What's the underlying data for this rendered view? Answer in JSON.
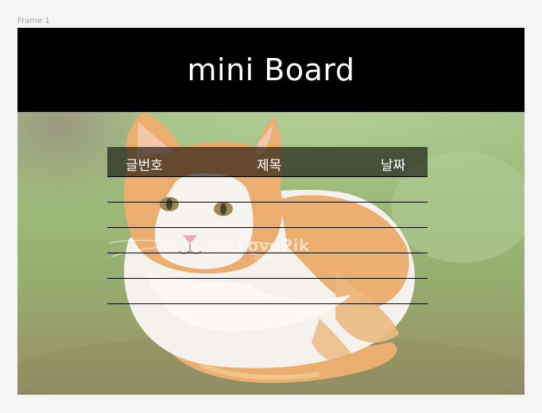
{
  "frame": {
    "label": "Frame 1"
  },
  "header": {
    "title": "mini Board"
  },
  "background_image": {
    "watermark": "LovePik",
    "watermark_sub": "lovepik.com"
  },
  "board": {
    "columns": {
      "number": "글번호",
      "title": "제목",
      "date": "날짜"
    },
    "rows": [
      {
        "number": "",
        "title": "",
        "date": ""
      },
      {
        "number": "",
        "title": "",
        "date": ""
      },
      {
        "number": "",
        "title": "",
        "date": ""
      },
      {
        "number": "",
        "title": "",
        "date": ""
      },
      {
        "number": "",
        "title": "",
        "date": ""
      }
    ]
  }
}
